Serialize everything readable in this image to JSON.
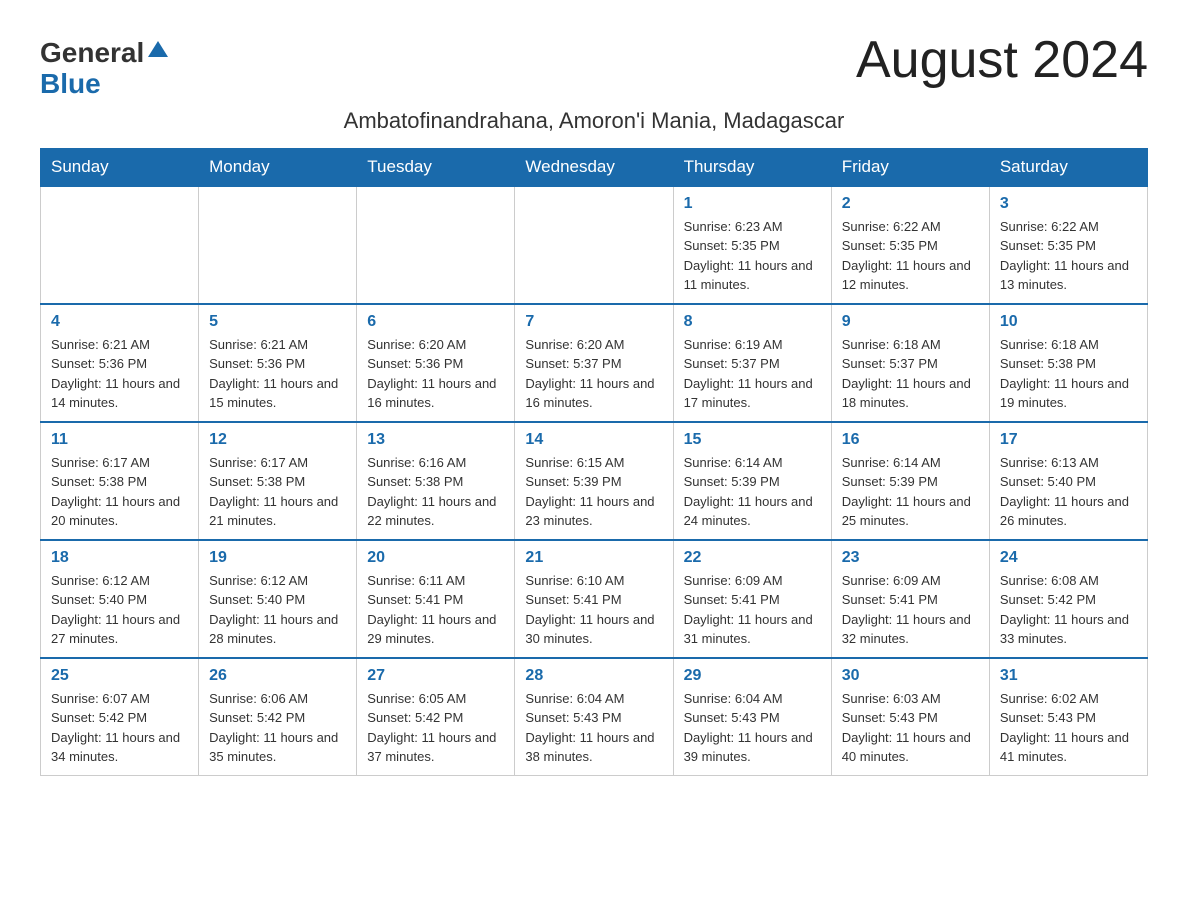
{
  "header": {
    "logo_general": "General",
    "logo_blue": "Blue",
    "month_title": "August 2024",
    "subtitle": "Ambatofinandrahana, Amoron'i Mania, Madagascar"
  },
  "days_of_week": [
    "Sunday",
    "Monday",
    "Tuesday",
    "Wednesday",
    "Thursday",
    "Friday",
    "Saturday"
  ],
  "weeks": [
    {
      "days": [
        {
          "number": "",
          "info": ""
        },
        {
          "number": "",
          "info": ""
        },
        {
          "number": "",
          "info": ""
        },
        {
          "number": "",
          "info": ""
        },
        {
          "number": "1",
          "info": "Sunrise: 6:23 AM\nSunset: 5:35 PM\nDaylight: 11 hours and 11 minutes."
        },
        {
          "number": "2",
          "info": "Sunrise: 6:22 AM\nSunset: 5:35 PM\nDaylight: 11 hours and 12 minutes."
        },
        {
          "number": "3",
          "info": "Sunrise: 6:22 AM\nSunset: 5:35 PM\nDaylight: 11 hours and 13 minutes."
        }
      ]
    },
    {
      "days": [
        {
          "number": "4",
          "info": "Sunrise: 6:21 AM\nSunset: 5:36 PM\nDaylight: 11 hours and 14 minutes."
        },
        {
          "number": "5",
          "info": "Sunrise: 6:21 AM\nSunset: 5:36 PM\nDaylight: 11 hours and 15 minutes."
        },
        {
          "number": "6",
          "info": "Sunrise: 6:20 AM\nSunset: 5:36 PM\nDaylight: 11 hours and 16 minutes."
        },
        {
          "number": "7",
          "info": "Sunrise: 6:20 AM\nSunset: 5:37 PM\nDaylight: 11 hours and 16 minutes."
        },
        {
          "number": "8",
          "info": "Sunrise: 6:19 AM\nSunset: 5:37 PM\nDaylight: 11 hours and 17 minutes."
        },
        {
          "number": "9",
          "info": "Sunrise: 6:18 AM\nSunset: 5:37 PM\nDaylight: 11 hours and 18 minutes."
        },
        {
          "number": "10",
          "info": "Sunrise: 6:18 AM\nSunset: 5:38 PM\nDaylight: 11 hours and 19 minutes."
        }
      ]
    },
    {
      "days": [
        {
          "number": "11",
          "info": "Sunrise: 6:17 AM\nSunset: 5:38 PM\nDaylight: 11 hours and 20 minutes."
        },
        {
          "number": "12",
          "info": "Sunrise: 6:17 AM\nSunset: 5:38 PM\nDaylight: 11 hours and 21 minutes."
        },
        {
          "number": "13",
          "info": "Sunrise: 6:16 AM\nSunset: 5:38 PM\nDaylight: 11 hours and 22 minutes."
        },
        {
          "number": "14",
          "info": "Sunrise: 6:15 AM\nSunset: 5:39 PM\nDaylight: 11 hours and 23 minutes."
        },
        {
          "number": "15",
          "info": "Sunrise: 6:14 AM\nSunset: 5:39 PM\nDaylight: 11 hours and 24 minutes."
        },
        {
          "number": "16",
          "info": "Sunrise: 6:14 AM\nSunset: 5:39 PM\nDaylight: 11 hours and 25 minutes."
        },
        {
          "number": "17",
          "info": "Sunrise: 6:13 AM\nSunset: 5:40 PM\nDaylight: 11 hours and 26 minutes."
        }
      ]
    },
    {
      "days": [
        {
          "number": "18",
          "info": "Sunrise: 6:12 AM\nSunset: 5:40 PM\nDaylight: 11 hours and 27 minutes."
        },
        {
          "number": "19",
          "info": "Sunrise: 6:12 AM\nSunset: 5:40 PM\nDaylight: 11 hours and 28 minutes."
        },
        {
          "number": "20",
          "info": "Sunrise: 6:11 AM\nSunset: 5:41 PM\nDaylight: 11 hours and 29 minutes."
        },
        {
          "number": "21",
          "info": "Sunrise: 6:10 AM\nSunset: 5:41 PM\nDaylight: 11 hours and 30 minutes."
        },
        {
          "number": "22",
          "info": "Sunrise: 6:09 AM\nSunset: 5:41 PM\nDaylight: 11 hours and 31 minutes."
        },
        {
          "number": "23",
          "info": "Sunrise: 6:09 AM\nSunset: 5:41 PM\nDaylight: 11 hours and 32 minutes."
        },
        {
          "number": "24",
          "info": "Sunrise: 6:08 AM\nSunset: 5:42 PM\nDaylight: 11 hours and 33 minutes."
        }
      ]
    },
    {
      "days": [
        {
          "number": "25",
          "info": "Sunrise: 6:07 AM\nSunset: 5:42 PM\nDaylight: 11 hours and 34 minutes."
        },
        {
          "number": "26",
          "info": "Sunrise: 6:06 AM\nSunset: 5:42 PM\nDaylight: 11 hours and 35 minutes."
        },
        {
          "number": "27",
          "info": "Sunrise: 6:05 AM\nSunset: 5:42 PM\nDaylight: 11 hours and 37 minutes."
        },
        {
          "number": "28",
          "info": "Sunrise: 6:04 AM\nSunset: 5:43 PM\nDaylight: 11 hours and 38 minutes."
        },
        {
          "number": "29",
          "info": "Sunrise: 6:04 AM\nSunset: 5:43 PM\nDaylight: 11 hours and 39 minutes."
        },
        {
          "number": "30",
          "info": "Sunrise: 6:03 AM\nSunset: 5:43 PM\nDaylight: 11 hours and 40 minutes."
        },
        {
          "number": "31",
          "info": "Sunrise: 6:02 AM\nSunset: 5:43 PM\nDaylight: 11 hours and 41 minutes."
        }
      ]
    }
  ]
}
